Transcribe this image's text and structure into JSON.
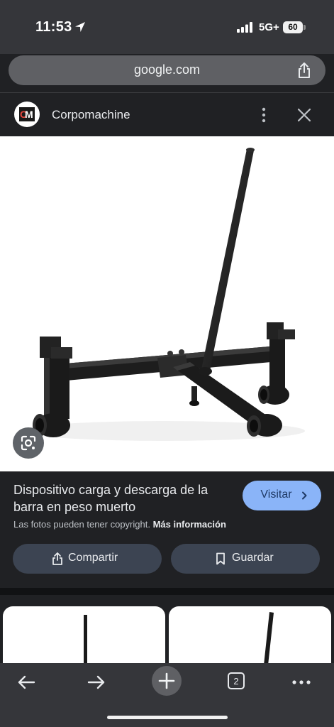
{
  "status_bar": {
    "time": "11:53",
    "network": "5G+",
    "battery": "60"
  },
  "url_bar": {
    "url": "google.com"
  },
  "site": {
    "logo_letters": "CM",
    "name": "Corpomachine"
  },
  "result": {
    "title": "Dispositivo carga y descarga de la barra en peso muerto",
    "visit_label": "Visitar",
    "copyright_text": "Las fotos pueden tener copyright.",
    "more_info_label": "Más información",
    "share_label": "Compartir",
    "save_label": "Guardar"
  },
  "toolbar": {
    "tab_count": "2"
  },
  "colors": {
    "accent": "#8ab4f8",
    "background": "#202124",
    "chrome": "#35363a"
  },
  "icons": [
    "location-arrow-icon",
    "signal-icon",
    "share-icon",
    "more-vert-icon",
    "close-icon",
    "lens-icon",
    "chevron-right-icon",
    "bookmark-icon",
    "back-icon",
    "forward-icon",
    "add-icon",
    "tabs-icon",
    "more-horiz-icon"
  ]
}
